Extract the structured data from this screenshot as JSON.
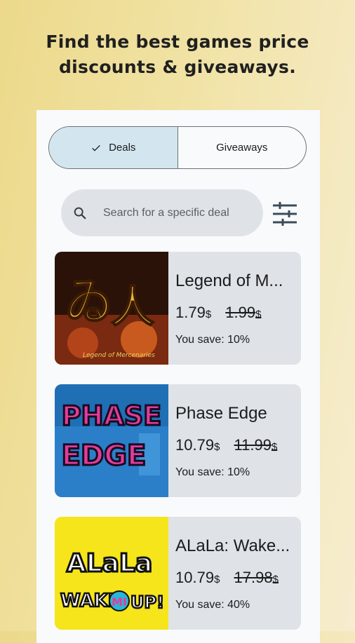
{
  "headline": {
    "line1": "Find the best games price",
    "line2": "discounts & giveaways."
  },
  "tabs": {
    "deals": "Deals",
    "giveaways": "Giveaways"
  },
  "search": {
    "placeholder": "Search for a specific deal"
  },
  "deals": [
    {
      "title": "Legend of M...",
      "sale_price": "1.79",
      "original_price": "1.99",
      "currency": "$",
      "save_label": "You save: 10%",
      "image_text": "Legend of Mercenaries"
    },
    {
      "title": "Phase Edge",
      "sale_price": "10.79",
      "original_price": "11.99",
      "currency": "$",
      "save_label": "You save: 10%",
      "image_text_1": "PHASE",
      "image_text_2": "EDGE"
    },
    {
      "title": "ALaLa: Wake...",
      "sale_price": "10.79",
      "original_price": "17.98",
      "currency": "$",
      "save_label": "You save: 40%",
      "image_text_1": "ALaLa",
      "image_text_2": "WAKE",
      "image_text_3": "MI",
      "image_text_4": "UP!"
    }
  ],
  "colors": {
    "segment_active": "#d3e6ef",
    "card_bg": "#dfe3e7",
    "page_bg_start": "#ecd98a",
    "page_bg_end": "#f6edcf"
  },
  "icons": {
    "check": "check-icon",
    "search": "search-icon",
    "filter": "filter-sliders-icon"
  }
}
